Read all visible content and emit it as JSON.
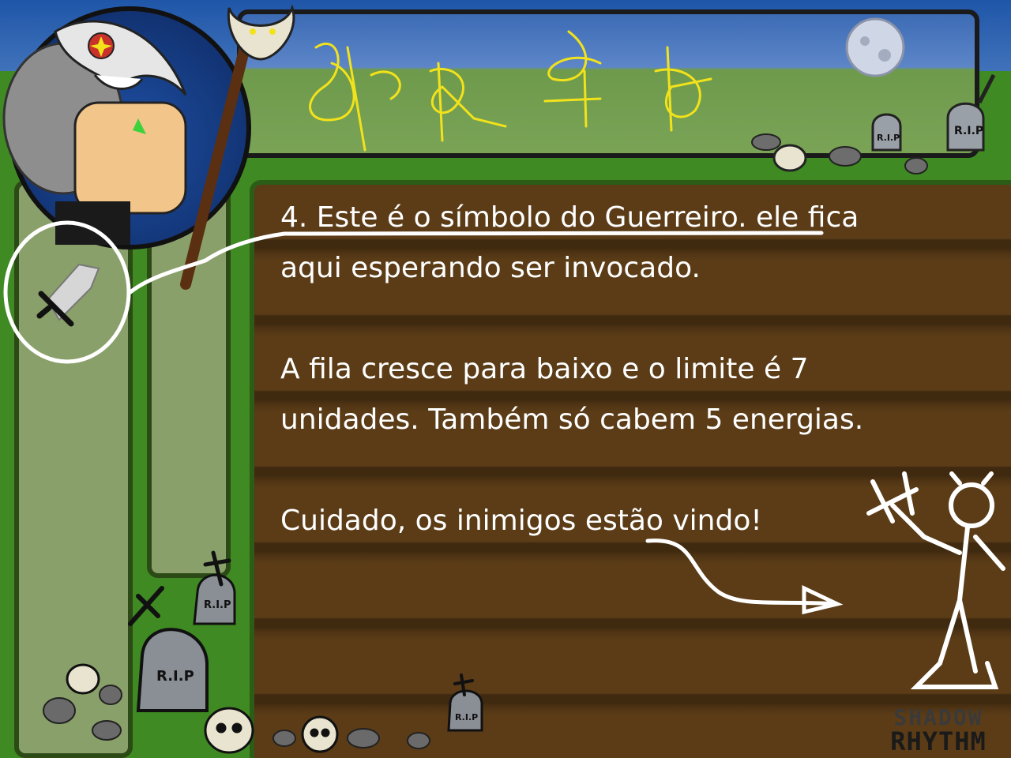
{
  "tutorial": {
    "line1a": "4. Este é o símbolo do Guerreiro. ele fica",
    "line1b": "aqui esperando ser invocado.",
    "line2a": "A fila cresce para baixo e o limite é 7",
    "line2b": "unidades. Também só cabem 5 energias.",
    "line3": "Cuidado, os inimigos estão vindo!"
  },
  "tombstone_text": "R.I.P",
  "logo": {
    "line1": "SHADOW",
    "line2": "RHYTHM"
  },
  "icons": {
    "warrior_slot": "sword-icon",
    "character": "warrior-portrait",
    "enemy": "devil-icon"
  },
  "colors": {
    "text": "#ffffff",
    "glyphs": "#f2e21b",
    "dirt": "#5b3c17",
    "grass": "#3f8a22"
  }
}
